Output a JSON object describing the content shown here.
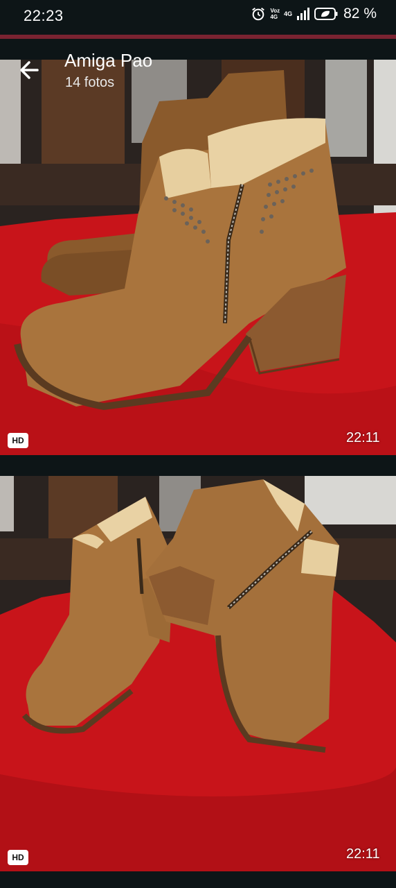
{
  "status_bar": {
    "time": "22:23",
    "network_top": "Voz",
    "network_sub": "4G",
    "network_type": "4G",
    "battery": "82 %",
    "battery_level": 0.82,
    "icons": [
      "alarm-icon",
      "signal-icon",
      "battery-icon"
    ]
  },
  "header": {
    "title": "Amiga Pao",
    "subtitle": "14 fotos",
    "back_icon": "arrow-left-icon"
  },
  "photos": [
    {
      "hd_label": "HD",
      "time": "22:11"
    },
    {
      "hd_label": "HD",
      "time": "22:11"
    }
  ],
  "colors": {
    "background": "#0d1517",
    "accent_bar": "#7a2331",
    "cloth_red": "#c8141a",
    "leather": "#a9743d"
  }
}
